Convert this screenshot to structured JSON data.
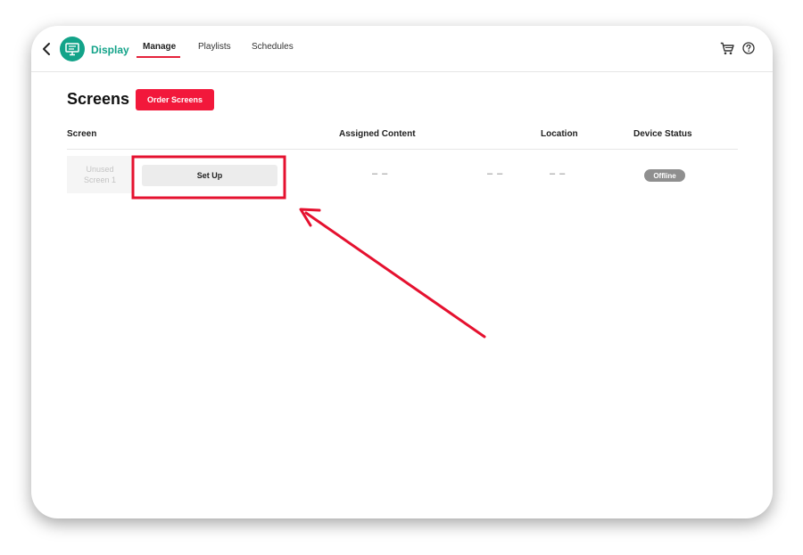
{
  "app": {
    "name": "Display",
    "logo_icon": "monitor-icon",
    "accent": "#13a389"
  },
  "nav": {
    "tabs": [
      {
        "label": "Manage",
        "active": true
      },
      {
        "label": "Playlists",
        "active": false
      },
      {
        "label": "Schedules",
        "active": false
      }
    ]
  },
  "header": {
    "cart_icon": "cart-icon",
    "help_icon": "help-icon"
  },
  "page": {
    "title": "Screens",
    "order_button": "Order Screens",
    "order_color": "#f2183b"
  },
  "table": {
    "columns": [
      "Screen",
      "Assigned Content",
      "Location",
      "Device Status"
    ],
    "rows": [
      {
        "screen_name_line1": "Unused",
        "screen_name_line2": "Screen 1",
        "action": "Set Up",
        "assigned_content": "– –",
        "extra": "– –",
        "location": "– –",
        "status": "Offline"
      }
    ]
  },
  "annotation": {
    "color": "#e5112f"
  }
}
